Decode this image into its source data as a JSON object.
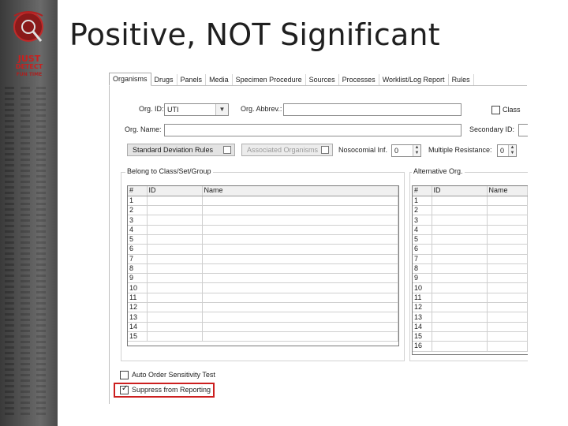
{
  "slide": {
    "title": "Positive, NOT Significant"
  },
  "logo": {
    "line1": "JUST",
    "line2": "DETECT",
    "line3": "FUN TIME"
  },
  "tabs": [
    "Organisms",
    "Drugs",
    "Panels",
    "Media",
    "Specimen Procedure",
    "Sources",
    "Processes",
    "Worklist/Log Report",
    "Rules"
  ],
  "form": {
    "org_id_label": "Org. ID:",
    "org_id_value": "UTI",
    "org_abbrev_label": "Org. Abbrev.:",
    "org_abbrev_value": "",
    "class_label": "Class",
    "org_name_label": "Org. Name:",
    "org_name_value": "",
    "secondary_id_label": "Secondary ID:",
    "std_dev_rules_label": "Standard Deviation Rules",
    "assoc_organisms_label": "Associated Organisms",
    "nosocomial_label": "Nosocomial Inf.",
    "nosocomial_value": "0",
    "multiple_resistance_label": "Multiple Resistance:",
    "multiple_resistance_value": "0"
  },
  "belong_group": {
    "title": "Belong to Class/Set/Group",
    "columns": [
      "#",
      "ID",
      "Name"
    ],
    "rows": [
      "1",
      "2",
      "3",
      "4",
      "5",
      "6",
      "7",
      "8",
      "9",
      "10",
      "11",
      "12",
      "13",
      "14",
      "15"
    ]
  },
  "alt_org": {
    "title": "Alternative Org.",
    "columns": [
      "#",
      "ID",
      "Name"
    ],
    "rows": [
      "1",
      "2",
      "3",
      "4",
      "5",
      "6",
      "7",
      "8",
      "9",
      "10",
      "11",
      "12",
      "13",
      "14",
      "15",
      "16"
    ]
  },
  "options": {
    "auto_order_label": "Auto Order Sensitivity Test",
    "auto_order_checked": false,
    "suppress_label": "Suppress from Reporting",
    "suppress_checked": true
  },
  "colors": {
    "highlight": "#cc1f1f",
    "strip_bg": "#585858"
  }
}
